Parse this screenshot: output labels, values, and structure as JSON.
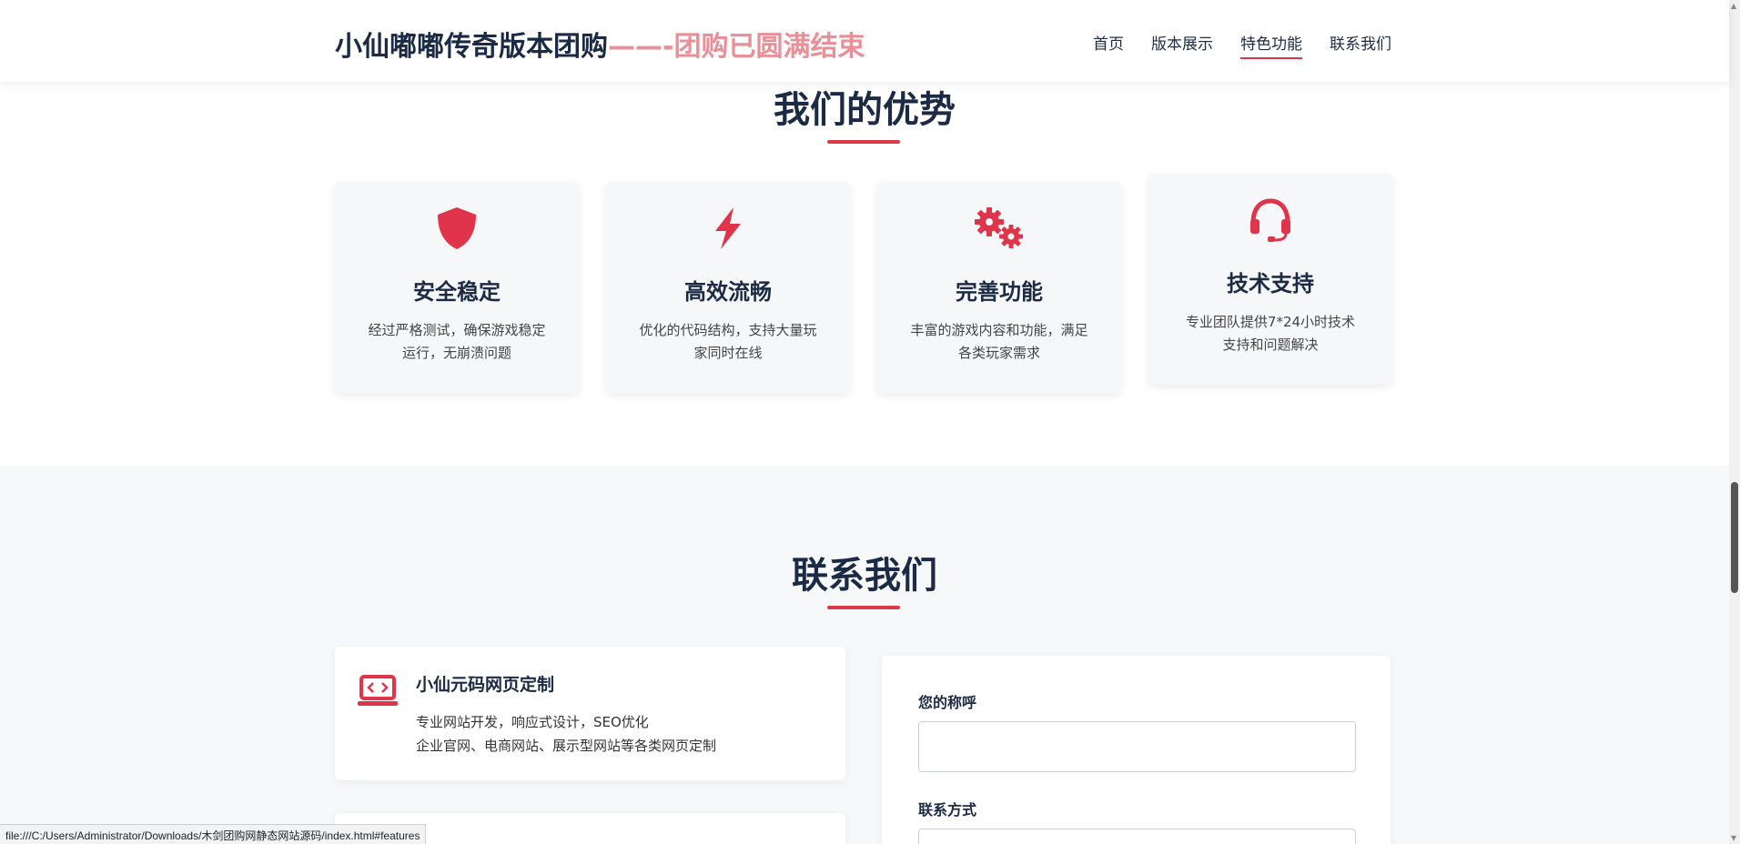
{
  "header": {
    "brand_main": "小仙嘟嘟传奇版本团购",
    "brand_accent": "——-团购已圆满结束",
    "nav": [
      {
        "label": "首页"
      },
      {
        "label": "版本展示"
      },
      {
        "label": "特色功能"
      },
      {
        "label": "联系我们"
      }
    ],
    "active_nav": "特色功能"
  },
  "advantages": {
    "title": "我们的优势",
    "cards": [
      {
        "icon": "shield-icon",
        "title": "安全稳定",
        "desc": "经过严格测试，确保游戏稳定运行，无崩溃问题"
      },
      {
        "icon": "lightning-icon",
        "title": "高效流畅",
        "desc": "优化的代码结构，支持大量玩家同时在线"
      },
      {
        "icon": "gears-icon",
        "title": "完善功能",
        "desc": "丰富的游戏内容和功能，满足各类玩家需求"
      },
      {
        "icon": "headset-icon",
        "title": "技术支持",
        "desc": "专业团队提供7*24小时技术支持和问题解决"
      }
    ]
  },
  "contact": {
    "title": "联系我们",
    "info": [
      {
        "icon": "laptop-code-icon",
        "title": "小仙元码网页定制",
        "line1": "专业网站开发，响应式设计，SEO优化",
        "line2": "企业官网、电商网站、展示型网站等各类网页定制"
      }
    ],
    "form": {
      "name_label": "您的称呼",
      "name_value": "",
      "contact_label": "联系方式",
      "contact_value": ""
    }
  },
  "status_url": "file:///C:/Users/Administrator/Downloads/木剑团购网静态网站源码/index.html#features",
  "colors": {
    "accent": "#e0344a",
    "navy": "#1c2b45",
    "brand_accent": "#e98f98"
  }
}
